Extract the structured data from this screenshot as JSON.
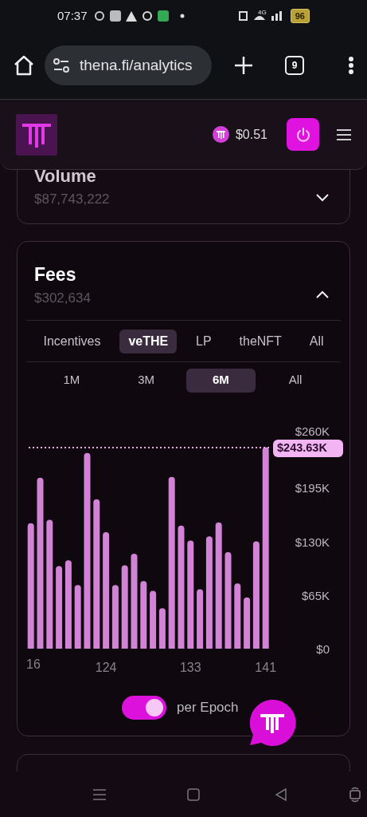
{
  "status_bar": {
    "time": "07:37",
    "battery": "96",
    "network": "4G"
  },
  "browser": {
    "url": "thena.fi/analytics",
    "tab_count": "9"
  },
  "header": {
    "price": "$0.51"
  },
  "volume_card": {
    "title": "Volume",
    "value": "$87,743,222",
    "expanded": false
  },
  "fees_card": {
    "title": "Fees",
    "value": "$302,634",
    "expanded": true,
    "tabs": [
      {
        "label": "Incentives",
        "selected": false
      },
      {
        "label": "veTHE",
        "selected": true
      },
      {
        "label": "LP",
        "selected": false
      },
      {
        "label": "theNFT",
        "selected": false
      },
      {
        "label": "All",
        "selected": false
      }
    ],
    "ranges": [
      {
        "label": "1M",
        "selected": false
      },
      {
        "label": "3M",
        "selected": false
      },
      {
        "label": "6M",
        "selected": true
      },
      {
        "label": "All",
        "selected": false
      }
    ],
    "chart_data": {
      "type": "bar",
      "x": [
        116,
        117,
        118,
        119,
        120,
        121,
        122,
        123,
        124,
        125,
        126,
        127,
        128,
        129,
        130,
        131,
        132,
        133,
        134,
        135,
        136,
        137,
        138,
        139,
        140,
        141
      ],
      "values": [
        152,
        207,
        156,
        100,
        107,
        77,
        237,
        181,
        141,
        77,
        101,
        115,
        82,
        70,
        49,
        208,
        149,
        131,
        72,
        136,
        153,
        117,
        79,
        62,
        130,
        244
      ],
      "xticks": [
        {
          "value": 124,
          "label": "124"
        },
        {
          "value": 133,
          "label": "133"
        },
        {
          "value": 141,
          "label": "141"
        }
      ],
      "yticks": [
        {
          "value": 0,
          "label": "$0"
        },
        {
          "value": 65,
          "label": "$65K"
        },
        {
          "value": 130,
          "label": "$130K"
        },
        {
          "value": 195,
          "label": "$195K"
        },
        {
          "value": 260,
          "label": "$260K"
        }
      ],
      "ylim": [
        0,
        260
      ],
      "xlim": [
        116,
        141
      ],
      "ref_lines": [
        {
          "axis": "y",
          "value": 243.63,
          "label": "$243.63K"
        }
      ]
    },
    "first_x_label_cut": "16",
    "per_epoch": {
      "label": "per Epoch",
      "on": true
    }
  }
}
